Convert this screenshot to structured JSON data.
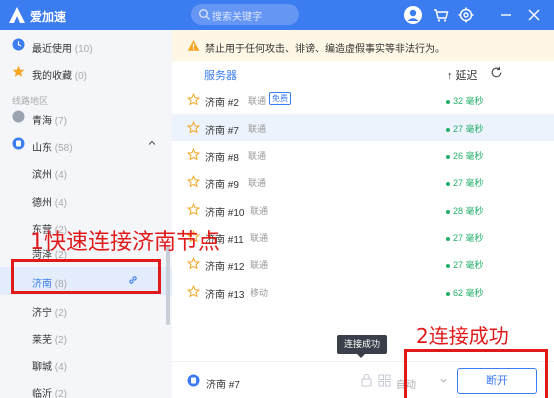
{
  "app": {
    "title": "爱加速"
  },
  "search": {
    "placeholder": "搜索关键字"
  },
  "sidebar": {
    "recent": {
      "label": "最近使用",
      "count": "(10)"
    },
    "favorites": {
      "label": "我的收藏",
      "count": "(0)"
    },
    "section_title": "线路地区",
    "regions": [
      {
        "label": "青海",
        "count": "(7)"
      },
      {
        "label": "山东",
        "count": "(58)"
      }
    ],
    "cities": [
      {
        "label": "滨州",
        "count": "(4)"
      },
      {
        "label": "德州",
        "count": "(4)"
      },
      {
        "label": "东营",
        "count": "(2)"
      },
      {
        "label": "菏泽",
        "count": "(2)"
      },
      {
        "label": "济南",
        "count": "(8)"
      },
      {
        "label": "济宁",
        "count": "(2)"
      },
      {
        "label": "莱芜",
        "count": "(2)"
      },
      {
        "label": "聊城",
        "count": "(4)"
      },
      {
        "label": "临沂",
        "count": "(2)"
      }
    ]
  },
  "notice": {
    "text": "禁止用于任何攻击、诽谤、编造虚假事实等非法行为。"
  },
  "table": {
    "col_server": "服务器",
    "col_latency": "↑ 延迟",
    "rows": [
      {
        "name": "济南 #2",
        "carrier": "联通",
        "badge": "免费",
        "latency": "32 毫秒"
      },
      {
        "name": "济南 #7",
        "carrier": "联通",
        "latency": "27 毫秒"
      },
      {
        "name": "济南 #8",
        "carrier": "联通",
        "latency": "26 毫秒"
      },
      {
        "name": "济南 #9",
        "carrier": "联通",
        "latency": "27 毫秒"
      },
      {
        "name": "济南 #10",
        "carrier": "联通",
        "latency": "28 毫秒"
      },
      {
        "name": "济南 #11",
        "carrier": "联通",
        "latency": "27 毫秒"
      },
      {
        "name": "济南 #12",
        "carrier": "联通",
        "latency": "27 毫秒"
      },
      {
        "name": "济南 #13",
        "carrier": "移动",
        "latency": "62 毫秒"
      }
    ]
  },
  "tooltip": {
    "text": "连接成功"
  },
  "footer": {
    "current_server": "济南 #7",
    "auto_label": "自动",
    "disconnect_label": "断开"
  },
  "annotations": {
    "step1": "1快速连接济南节点",
    "step2": "2连接成功"
  },
  "colors": {
    "accent": "#3c7cf1",
    "latency_good": "#22b06a",
    "annotation": "#e01a1a"
  },
  "icons": [
    "logo-icon",
    "search-icon",
    "avatar-icon",
    "cart-icon",
    "gear-icon",
    "minimize-icon",
    "close-icon",
    "clock-icon",
    "star-icon",
    "location-icon",
    "chevron-up-icon",
    "link-icon",
    "warning-icon",
    "refresh-icon",
    "lock-icon",
    "grid-icon",
    "dropdown-icon"
  ]
}
